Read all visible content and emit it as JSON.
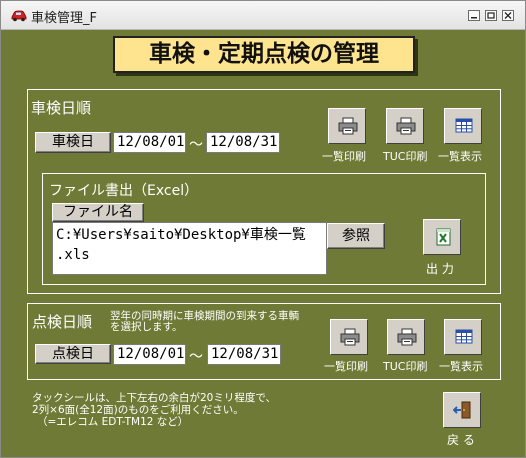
{
  "window": {
    "title": "車検管理_F",
    "controls": [
      "minimize",
      "restore",
      "close"
    ]
  },
  "header": {
    "title": "車検・定期点検の管理"
  },
  "shaken": {
    "group_label": "車検日順",
    "date_button": "車検日",
    "from_date": "12/08/01",
    "separator": "～",
    "to_date": "12/08/31",
    "buttons": [
      {
        "label": "一覧印刷",
        "icon": "printer-icon"
      },
      {
        "label": "TUC印刷",
        "icon": "printer-icon"
      },
      {
        "label": "一覧表示",
        "icon": "table-icon"
      }
    ]
  },
  "file_export": {
    "group_label": "ファイル書出（Excel）",
    "filename_button": "ファイル名",
    "path_line1": "C:¥Users¥saito¥Desktop¥車検一覧",
    "path_line2": ".xls",
    "browse_button": "参照",
    "output_label": "出 力",
    "output_icon": "excel-icon"
  },
  "inspection": {
    "group_label": "点検日順",
    "note_line1": "翌年の同時期に車検期間の到来する車輌",
    "note_line2": "を選択します。",
    "date_button": "点検日",
    "from_date": "12/08/01",
    "separator": "～",
    "to_date": "12/08/31",
    "buttons": [
      {
        "label": "一覧印刷",
        "icon": "printer-icon"
      },
      {
        "label": "TUC印刷",
        "icon": "printer-icon"
      },
      {
        "label": "一覧表示",
        "icon": "table-icon"
      }
    ]
  },
  "footer": {
    "note_line1": "タックシールは、上下左右の余白が20ミリ程度で、",
    "note_line2": "2列×6面(全12面)のものをご利用ください。",
    "note_line3": "（=エレコム EDT-TM12 など）",
    "back_label": "戻 る",
    "back_icon": "exit-door-icon"
  },
  "colors": {
    "background": "#6f7a36",
    "header_fill": "#ffe48f",
    "button_face": "#d4d0c8"
  }
}
